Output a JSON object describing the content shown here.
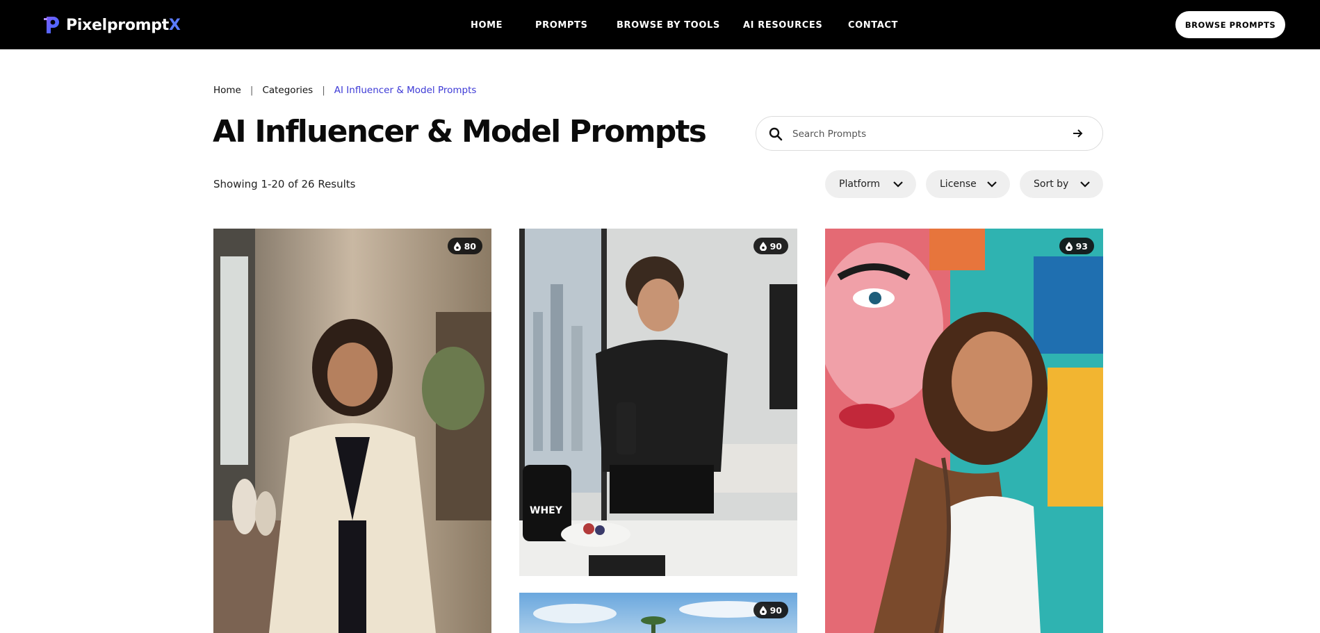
{
  "header": {
    "logo_text": "Pixelprompt",
    "logo_x": "X",
    "nav": [
      "HOME",
      "PROMPTS",
      "BROWSE BY TOOLS",
      "AI RESOURCES",
      "CONTACT"
    ],
    "cta_label": "BROWSE PROMPTS"
  },
  "breadcrumb": {
    "home": "Home",
    "categories": "Categories",
    "current": "AI Influencer & Model Prompts",
    "separator": "|"
  },
  "page": {
    "title": "AI Influencer & Model Prompts",
    "results_text": "Showing 1-20 of 26 Results"
  },
  "search": {
    "placeholder": "Search Prompts"
  },
  "filters": {
    "platform": "Platform",
    "license": "License",
    "sort": "Sort by"
  },
  "cards": [
    {
      "score": "80",
      "icon": "drop-icon"
    },
    {
      "score": "90",
      "icon": "drop-icon"
    },
    {
      "score": "93",
      "icon": "drop-icon"
    },
    {
      "score": "90",
      "icon": "drop-icon"
    }
  ],
  "colors": {
    "header_bg": "#000000",
    "accent": "#3d3ad6",
    "logo_x": "#5b7cff",
    "filter_bg": "#efefef"
  }
}
